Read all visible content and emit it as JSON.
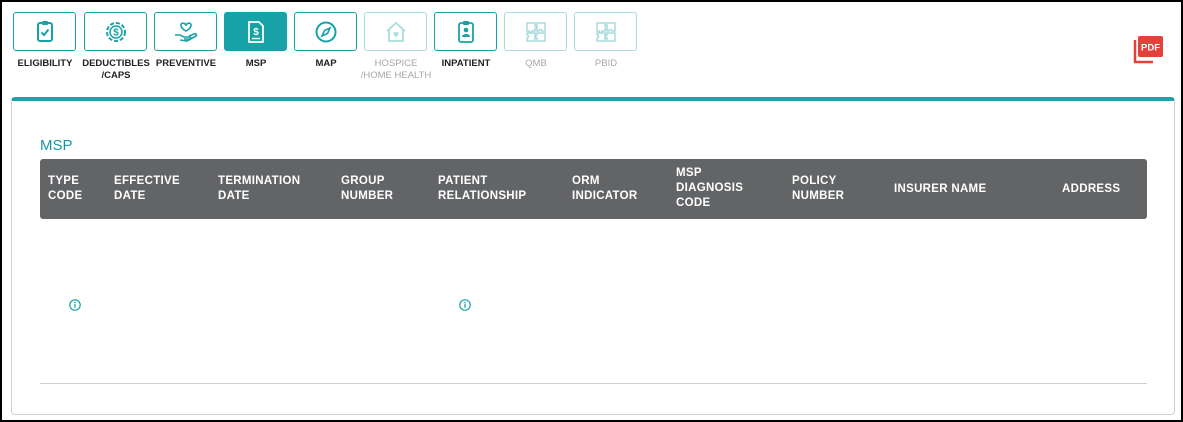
{
  "tabs": [
    {
      "label": "ELIGIBILITY",
      "icon": "clipboard-check-icon",
      "state": "normal"
    },
    {
      "label": "DEDUCTIBLES\n/CAPS",
      "icon": "dollar-gear-icon",
      "state": "normal"
    },
    {
      "label": "PREVENTIVE",
      "icon": "hand-heart-icon",
      "state": "normal"
    },
    {
      "label": "MSP",
      "icon": "dollar-document-icon",
      "state": "active"
    },
    {
      "label": "MAP",
      "icon": "compass-icon",
      "state": "normal"
    },
    {
      "label": "HOSPICE\n/HOME HEALTH",
      "icon": "house-heart-icon",
      "state": "disabled"
    },
    {
      "label": "INPATIENT",
      "icon": "id-badge-icon",
      "state": "normal"
    },
    {
      "label": "QMB",
      "icon": "puzzle-icon",
      "state": "disabled"
    },
    {
      "label": "PBID",
      "icon": "puzzle-icon",
      "state": "disabled"
    }
  ],
  "pdf_button": {
    "text": "PDF",
    "icon": "pdf-icon"
  },
  "section": {
    "title": "MSP"
  },
  "table": {
    "columns": [
      "TYPE\nCODE",
      "EFFECTIVE\nDATE",
      "TERMINATION\nDATE",
      "GROUP\nNUMBER",
      "PATIENT\nRELATIONSHIP",
      "ORM\nINDICATOR",
      "MSP\nDIAGNOSIS\nCODE",
      "POLICY\nNUMBER",
      "INSURER NAME",
      "ADDRESS"
    ],
    "row_icons": [
      "info-icon",
      "info-icon"
    ]
  },
  "colors": {
    "accent": "#17a2a8",
    "accent_disabled": "#a9dcde",
    "header_bg": "#636466",
    "title": "#1794a6",
    "pdf_red": "#e2413c"
  }
}
